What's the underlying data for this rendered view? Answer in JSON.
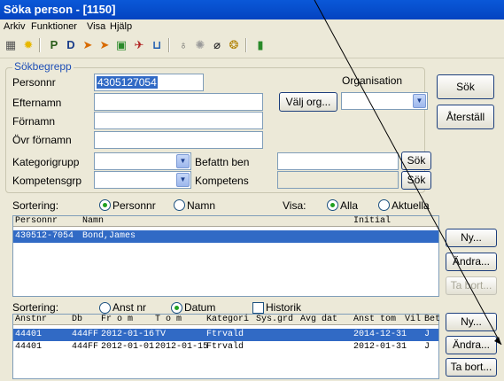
{
  "window": {
    "title": "Söka person  - [1150]"
  },
  "menu": [
    "Arkiv",
    "Funktioner",
    "Visa",
    "Hjälp"
  ],
  "toolbar_icons": [
    "grid-icon",
    "star-icon",
    "p-icon",
    "d-icon",
    "arrow-icon",
    "arrow2-icon",
    "form-icon",
    "car-icon",
    "chair-icon",
    "bulb-icon",
    "sun-icon",
    "compass-icon",
    "money-icon",
    "exit-icon"
  ],
  "search": {
    "legend": "Sökbegrepp",
    "personnr_label": "Personnr",
    "personnr_value": "4305127054",
    "efternamn_label": "Efternamn",
    "fornamn_label": "Förnamn",
    "ovrfornamn_label": "Övr förnamn",
    "kategorigrupp_label": "Kategorigrupp",
    "kompetensgrp_label": "Kompetensgrp",
    "befattning_label": "Befattn ben",
    "kompetens_label": "Kompetens",
    "organisation_label": "Organisation",
    "valj_org_button": "Välj org...",
    "sok_small_1": "Sök",
    "sok_small_2": "Sök"
  },
  "actions": {
    "sok": "Sök",
    "aterstall": "Återställ"
  },
  "sort1": {
    "label": "Sortering:",
    "opt_personnr": "Personnr",
    "opt_namn": "Namn",
    "visa_label": "Visa:",
    "opt_alla": "Alla",
    "opt_aktuella": "Aktuella"
  },
  "persons": {
    "headers": [
      "Personnr",
      "Namn",
      "Initial"
    ],
    "rows": [
      {
        "personnr": "430512-7054",
        "namn": "Bond,James",
        "initial": ""
      }
    ]
  },
  "person_buttons": {
    "ny": "Ny...",
    "andra": "Ändra...",
    "tabort": "Ta bort..."
  },
  "sort2": {
    "label": "Sortering:",
    "opt_anstnr": "Anst nr",
    "opt_datum": "Datum",
    "historik": "Historik"
  },
  "employments": {
    "headers": [
      "Anstnr",
      "Db",
      "Fr o m",
      "T o m",
      "Kategori",
      "Sys.grd",
      "Avg dat",
      "Anst tom",
      "Vil",
      "Bet"
    ],
    "rows": [
      {
        "anstnr": "44401",
        "db": "444FF",
        "from": "2012-01-16",
        "tom": "TV",
        "kategori": "Ftrvald",
        "sysgrd": "",
        "avgdat": "",
        "anst_tom": "2014-12-31",
        "vil": "J"
      },
      {
        "anstnr": "44401",
        "db": "444FF",
        "from": "2012-01-01",
        "tom": "2012-01-15",
        "kategori": "Ftrvald",
        "sysgrd": "",
        "avgdat": "",
        "anst_tom": "2012-01-31",
        "vil": "J"
      }
    ]
  },
  "employment_buttons": {
    "ny": "Ny...",
    "andra": "Ändra...",
    "tabort": "Ta bort..."
  }
}
